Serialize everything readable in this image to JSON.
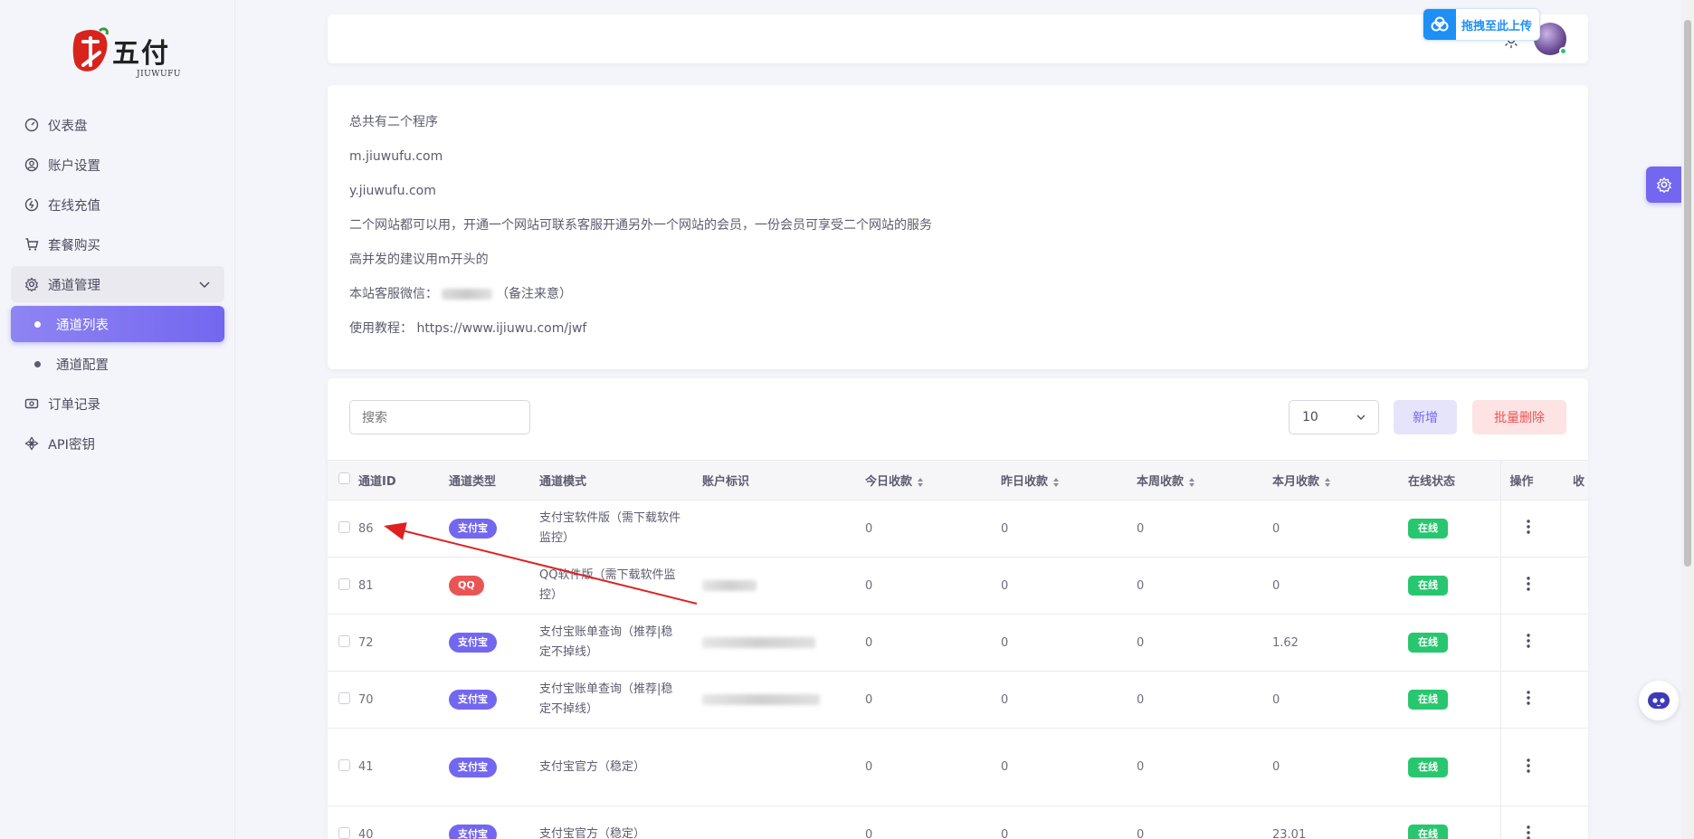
{
  "brand": {
    "name": "九五付",
    "sub": "JIUWUFU"
  },
  "sidebar": {
    "items": [
      {
        "label": "仪表盘",
        "icon": "dashboard-icon"
      },
      {
        "label": "账户设置",
        "icon": "user-settings-icon"
      },
      {
        "label": "在线充值",
        "icon": "recharge-icon"
      },
      {
        "label": "套餐购买",
        "icon": "cart-icon"
      },
      {
        "label": "通道管理",
        "icon": "channel-settings-icon"
      },
      {
        "label": "通道列表"
      },
      {
        "label": "通道配置"
      },
      {
        "label": "订单记录",
        "icon": "order-icon"
      },
      {
        "label": "API密钥",
        "icon": "api-key-icon"
      }
    ]
  },
  "header": {
    "upload_label": "拖拽至此上传"
  },
  "info": {
    "lines": [
      "总共有二个程序",
      "m.jiuwufu.com",
      "y.jiuwufu.com",
      "二个网站都可以用，开通一个网站可联系客服开通另外一个网站的会员，一份会员可享受二个网站的服务",
      "高并发的建议用m开头的"
    ],
    "wechat_prefix": "本站客服微信：",
    "wechat_suffix": "（备注来意）",
    "tutorial": "使用教程： https://www.ijiuwu.com/jwf"
  },
  "toolbar": {
    "search_placeholder": "搜索",
    "page_size": "10",
    "add_label": "新增",
    "batch_delete_label": "批量删除"
  },
  "table": {
    "columns": [
      "通道ID",
      "通道类型",
      "通道模式",
      "账户标识",
      "今日收款",
      "昨日收款",
      "本周收款",
      "本月收款",
      "在线状态",
      "操作",
      "收"
    ],
    "rows": [
      {
        "id": "86",
        "type": "支付宝",
        "mode": "支付宝软件版（需下载软件监控）",
        "today": "0",
        "yesterday": "0",
        "week": "0",
        "month": "0",
        "status": "在线"
      },
      {
        "id": "81",
        "type": "QQ",
        "mode": "QQ软件版（需下载软件监控）",
        "today": "0",
        "yesterday": "0",
        "week": "0",
        "month": "0",
        "status": "在线"
      },
      {
        "id": "72",
        "type": "支付宝",
        "mode": "支付宝账单查询（推荐|稳定不掉线）",
        "today": "0",
        "yesterday": "0",
        "week": "0",
        "month": "1.62",
        "status": "在线"
      },
      {
        "id": "70",
        "type": "支付宝",
        "mode": "支付宝账单查询（推荐|稳定不掉线）",
        "today": "0",
        "yesterday": "0",
        "week": "0",
        "month": "0",
        "status": "在线"
      },
      {
        "id": "41",
        "type": "支付宝",
        "mode": "支付宝官方（稳定）",
        "today": "0",
        "yesterday": "0",
        "week": "0",
        "month": "0",
        "status": "在线"
      },
      {
        "id": "40",
        "type": "支付宝",
        "mode": "支付宝官方（稳定）",
        "today": "0",
        "yesterday": "0",
        "week": "0",
        "month": "23.01",
        "status": "在线"
      }
    ]
  }
}
